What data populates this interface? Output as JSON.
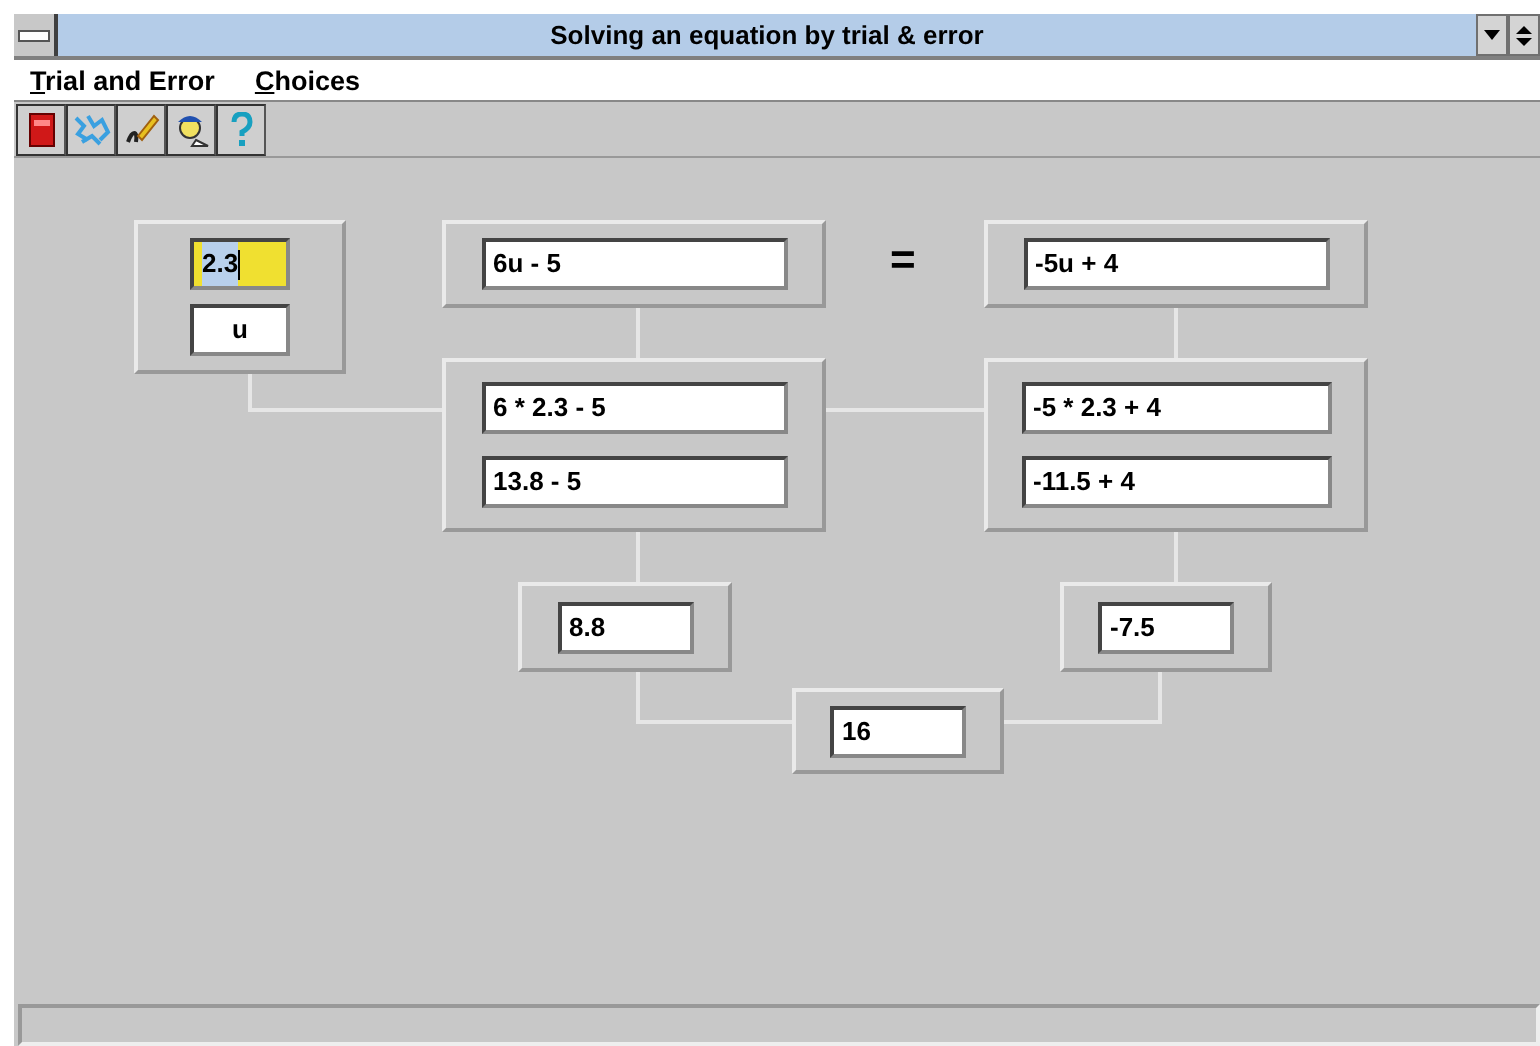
{
  "window": {
    "title": "Solving an equation by trial & error"
  },
  "menu": [
    {
      "label": "Trial and Error"
    },
    {
      "label": "Choices"
    }
  ],
  "equation": {
    "variable": {
      "value": {
        "text": "2.3",
        "selected": true
      },
      "name": {
        "text": "u",
        "selected": false
      }
    },
    "left": {
      "expression": "6u - 5",
      "substituted": "6 * 2.3 - 5",
      "simplified": "13.8 - 5",
      "result": "8.8"
    },
    "equals_sign": "=",
    "right": {
      "expression": "-5u + 4",
      "substituted": "-5 * 2.3 + 4",
      "simplified": "-11.5 + 4",
      "result": "-7.5"
    },
    "difference": "16"
  }
}
